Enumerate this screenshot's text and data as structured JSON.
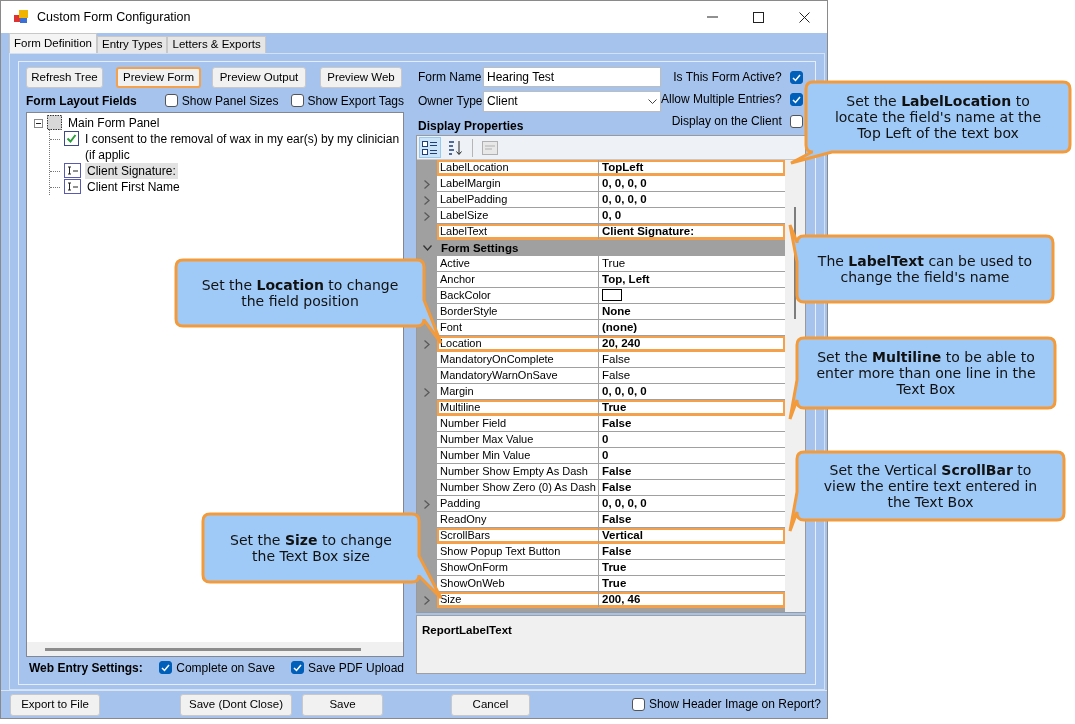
{
  "window": {
    "title": "Custom Form Configuration"
  },
  "tabs": [
    {
      "label": "Form Definition",
      "selected": true
    },
    {
      "label": "Entry Types",
      "selected": false
    },
    {
      "label": "Letters & Exports",
      "selected": false
    }
  ],
  "left_panel": {
    "buttons": [
      {
        "label": "Refresh Tree",
        "focused": false
      },
      {
        "label": "Preview Form",
        "focused": true
      },
      {
        "label": "Preview Output",
        "focused": false
      },
      {
        "label": "Preview Web",
        "focused": false
      }
    ],
    "heading": "Form Layout Fields",
    "options": [
      {
        "label": "Show Panel Sizes",
        "checked": false
      },
      {
        "label": "Show Export Tags",
        "checked": false
      }
    ],
    "tree": [
      {
        "label": "Main Form Panel",
        "kind": "panel",
        "expanded": true,
        "selected": false,
        "children": [
          {
            "label": "I consent to the removal of wax in my ear(s) by my clinician (if applic",
            "kind": "checkbox",
            "selected": false
          },
          {
            "label": "Client Signature:",
            "kind": "textbox",
            "selected": true
          },
          {
            "label": "Client First Name",
            "kind": "textbox",
            "selected": false
          }
        ]
      }
    ],
    "web_entry": {
      "label": "Web Entry Settings:",
      "options": [
        {
          "label": "Complete on Save",
          "checked": true
        },
        {
          "label": "Save PDF Upload",
          "checked": true
        }
      ]
    }
  },
  "form_fields": [
    {
      "label": "Form Name",
      "kind": "text",
      "value": "Hearing Test"
    },
    {
      "label": "Owner Type",
      "kind": "select",
      "value": "Client"
    }
  ],
  "form_flags": [
    {
      "label": "Is This Form Active?",
      "checked": true
    },
    {
      "label": "Allow Multiple Entries?",
      "checked": true
    },
    {
      "label": "Display on the Client",
      "checked": false
    }
  ],
  "display_properties": {
    "heading": "Display Properties",
    "toolbar": [
      {
        "kind": "categorized",
        "selected": true,
        "disabled": false
      },
      {
        "kind": "alphabetical",
        "selected": false,
        "disabled": false
      },
      {
        "kind": "property-pages",
        "selected": false,
        "disabled": true
      }
    ],
    "rows": [
      {
        "kind": "property",
        "name": "LabelLocation",
        "value": "TopLeft",
        "modified": true,
        "expandable": false,
        "highlighted": true
      },
      {
        "kind": "property",
        "name": "LabelMargin",
        "value": "0, 0, 0, 0",
        "modified": true,
        "expandable": true,
        "highlighted": false
      },
      {
        "kind": "property",
        "name": "LabelPadding",
        "value": "0, 0, 0, 0",
        "modified": true,
        "expandable": true,
        "highlighted": false
      },
      {
        "kind": "property",
        "name": "LabelSize",
        "value": "0, 0",
        "modified": true,
        "expandable": true,
        "highlighted": false
      },
      {
        "kind": "property",
        "name": "LabelText",
        "value": "Client Signature:",
        "modified": true,
        "expandable": false,
        "highlighted": true
      },
      {
        "kind": "category",
        "name": "Form Settings",
        "expanded": true
      },
      {
        "kind": "property",
        "name": "Active",
        "value": "True",
        "modified": false,
        "expandable": false,
        "highlighted": false
      },
      {
        "kind": "property",
        "name": "Anchor",
        "value": "Top, Left",
        "modified": true,
        "expandable": false,
        "highlighted": false
      },
      {
        "kind": "color",
        "name": "BackColor",
        "modified": false,
        "expandable": false,
        "highlighted": false
      },
      {
        "kind": "property",
        "name": "BorderStyle",
        "value": "None",
        "modified": true,
        "expandable": false,
        "highlighted": false
      },
      {
        "kind": "property",
        "name": "Font",
        "value": "(none)",
        "modified": true,
        "expandable": false,
        "highlighted": false
      },
      {
        "kind": "property",
        "name": "Location",
        "value": "20, 240",
        "modified": true,
        "expandable": true,
        "highlighted": true
      },
      {
        "kind": "property",
        "name": "MandatoryOnComplete",
        "value": "False",
        "modified": false,
        "expandable": false,
        "highlighted": false
      },
      {
        "kind": "property",
        "name": "MandatoryWarnOnSave",
        "value": "False",
        "modified": false,
        "expandable": false,
        "highlighted": false
      },
      {
        "kind": "property",
        "name": "Margin",
        "value": "0, 0, 0, 0",
        "modified": true,
        "expandable": true,
        "highlighted": false
      },
      {
        "kind": "property",
        "name": "Multiline",
        "value": "True",
        "modified": true,
        "expandable": false,
        "highlighted": true
      },
      {
        "kind": "property",
        "name": "Number Field",
        "value": "False",
        "modified": true,
        "expandable": false,
        "highlighted": false
      },
      {
        "kind": "property",
        "name": "Number Max Value",
        "value": "0",
        "modified": true,
        "expandable": false,
        "highlighted": false
      },
      {
        "kind": "property",
        "name": "Number Min Value",
        "value": "0",
        "modified": true,
        "expandable": false,
        "highlighted": false
      },
      {
        "kind": "property",
        "name": "Number Show Empty As Dash",
        "value": "False",
        "modified": true,
        "expandable": false,
        "highlighted": false
      },
      {
        "kind": "property",
        "name": "Number Show Zero (0) As Dash",
        "value": "False",
        "modified": true,
        "expandable": false,
        "highlighted": false
      },
      {
        "kind": "property",
        "name": "Padding",
        "value": "0, 0, 0, 0",
        "modified": true,
        "expandable": true,
        "highlighted": false
      },
      {
        "kind": "property",
        "name": "ReadOny",
        "value": "False",
        "modified": true,
        "expandable": false,
        "highlighted": false
      },
      {
        "kind": "property",
        "name": "ScrollBars",
        "value": "Vertical",
        "modified": true,
        "expandable": false,
        "highlighted": true
      },
      {
        "kind": "property",
        "name": "Show Popup Text Button",
        "value": "False",
        "modified": true,
        "expandable": false,
        "highlighted": false
      },
      {
        "kind": "property",
        "name": "ShowOnForm",
        "value": "True",
        "modified": true,
        "expandable": false,
        "highlighted": false
      },
      {
        "kind": "property",
        "name": "ShowOnWeb",
        "value": "True",
        "modified": true,
        "expandable": false,
        "highlighted": false
      },
      {
        "kind": "property",
        "name": "Size",
        "value": "200, 46",
        "modified": true,
        "expandable": true,
        "highlighted": true
      }
    ],
    "description": {
      "title": "ReportLabelText"
    }
  },
  "footer": {
    "buttons": [
      {
        "label": "Export to File"
      },
      {
        "label": "Save (Dont Close)"
      },
      {
        "label": "Save"
      },
      {
        "label": "Cancel"
      }
    ],
    "option": {
      "label": "Show Header Image on Report?",
      "checked": false
    }
  },
  "callouts": [
    {
      "text": "Set the **LabelLocation** to locate the field's name at the Top Left of the text box"
    },
    {
      "text": "The **LabelText** can be used to change the field's name"
    },
    {
      "text": "Set the **Multiline** to be able to enter more than one line in the Text Box"
    },
    {
      "text": "Set the Vertical **ScrollBar** to view the entire text entered in the Text Box"
    },
    {
      "text": "Set the **Location** to change the field position"
    },
    {
      "text": "Set the **Size** to change the Text Box size"
    }
  ]
}
